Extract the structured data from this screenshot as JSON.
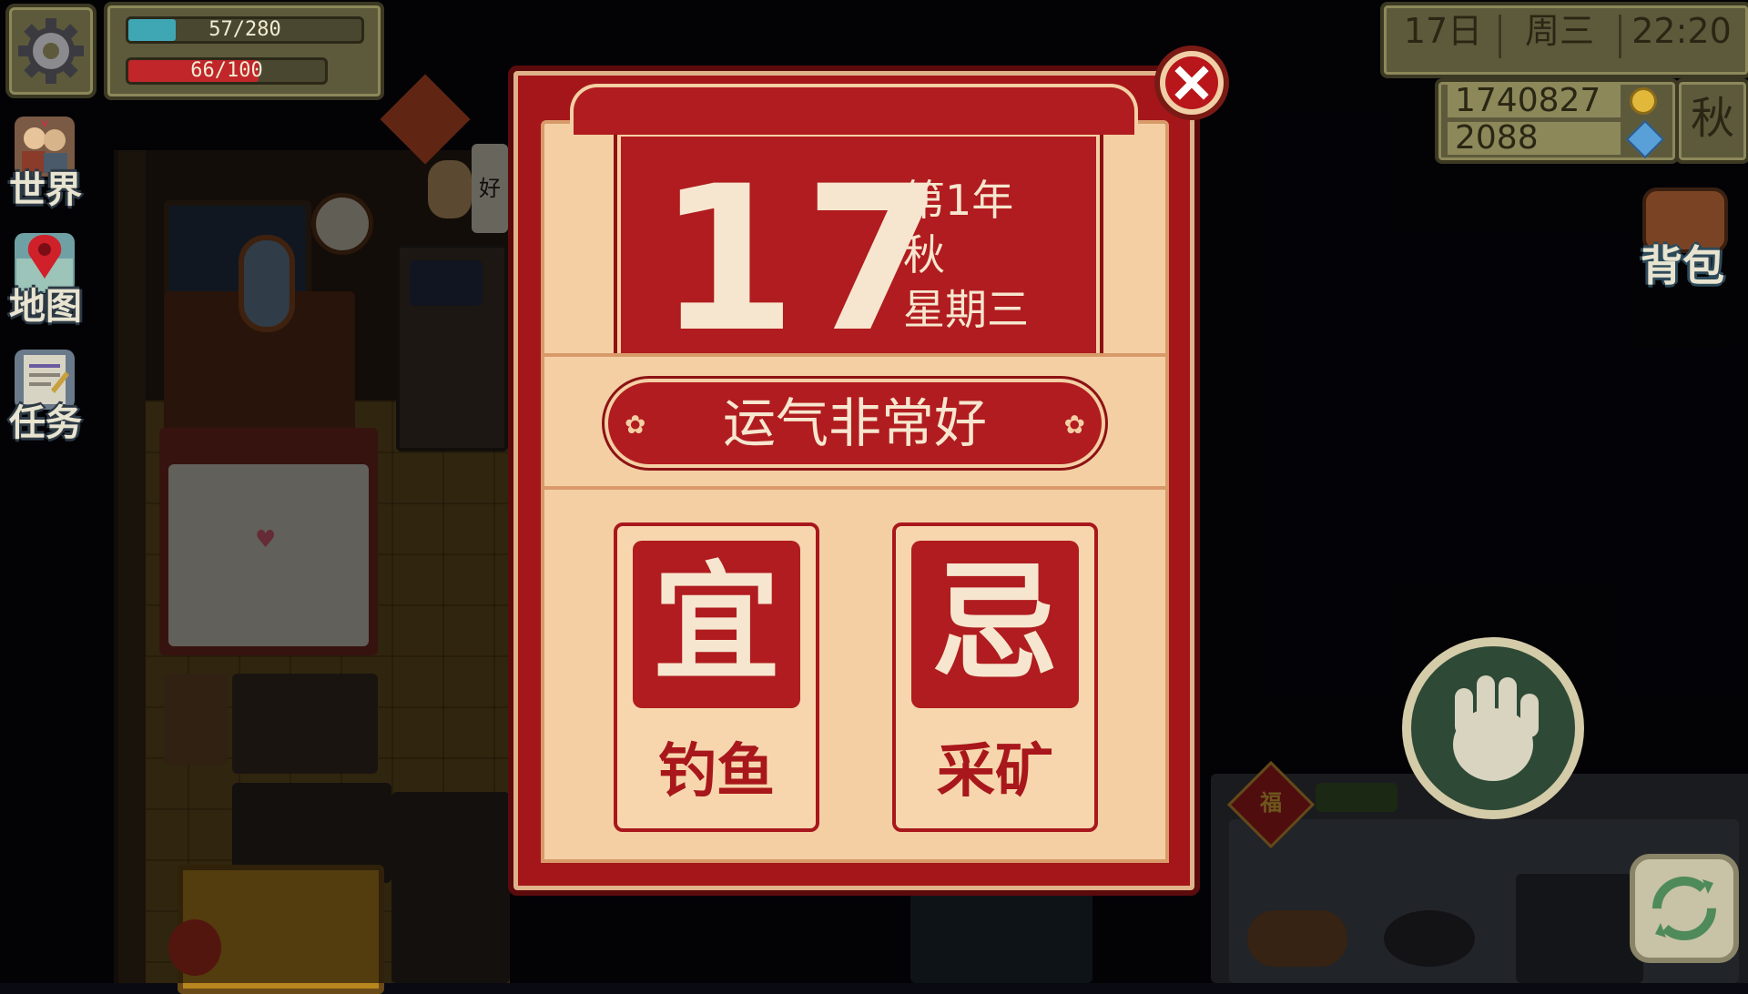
{
  "hud": {
    "energy_text": "57/280",
    "energy_fraction": 0.2036,
    "health_text": "66/100",
    "health_fraction": 0.66,
    "energy_color": "#3fa6b4",
    "health_color": "#c0262a",
    "date_day": "17日",
    "date_weekday": "周三",
    "time": "22:20",
    "gold": "1740827",
    "gems": "2088",
    "season": "秋",
    "gold_icon": "gold-coin-icon",
    "gem_icon": "blue-gem-icon"
  },
  "sidebar": {
    "items": [
      {
        "label": "世界",
        "icon": "people-icon"
      },
      {
        "label": "地图",
        "icon": "map-pin-icon"
      },
      {
        "label": "任务",
        "icon": "quest-scroll-icon"
      }
    ],
    "settings_icon": "gear-icon"
  },
  "right": {
    "backpack_label": "背包",
    "backpack_icon": "backpack-icon",
    "interact_icon": "hand-icon",
    "cycle_icon": "refresh-icon"
  },
  "scene": {
    "sign_text": "好",
    "door_text": "福"
  },
  "calendar": {
    "day_number": "17",
    "year": "第1年",
    "season": "秋",
    "weekday": "星期三",
    "luck": "运气非常好",
    "good_symbol": "宜",
    "good_activity": "钓鱼",
    "bad_symbol": "忌",
    "bad_activity": "采矿",
    "close_icon": "close-x-icon",
    "accent_color": "#a8171b"
  }
}
